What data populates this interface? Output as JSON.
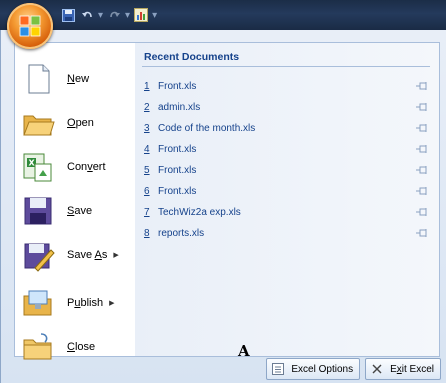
{
  "left_menu": [
    {
      "key": "new",
      "label": "New",
      "underline": "N",
      "has_arrow": false,
      "icon": "new-document-icon"
    },
    {
      "key": "open",
      "label": "Open",
      "underline": "O",
      "has_arrow": false,
      "icon": "open-folder-icon"
    },
    {
      "key": "convert",
      "label": "Convert",
      "underline": "v",
      "has_arrow": false,
      "icon": "convert-icon"
    },
    {
      "key": "save",
      "label": "Save",
      "underline": "S",
      "has_arrow": false,
      "icon": "save-icon"
    },
    {
      "key": "save_as",
      "label": "Save As",
      "underline": "A",
      "has_arrow": true,
      "icon": "save-as-icon"
    },
    {
      "key": "publish",
      "label": "Publish",
      "underline": "u",
      "has_arrow": true,
      "icon": "publish-icon"
    },
    {
      "key": "close",
      "label": "Close",
      "underline": "C",
      "has_arrow": false,
      "icon": "close-folder-icon"
    }
  ],
  "recent": {
    "title": "Recent Documents",
    "documents": [
      {
        "num": "1",
        "name": "Front.xls"
      },
      {
        "num": "2",
        "name": "admin.xls"
      },
      {
        "num": "3",
        "name": "Code of the month.xls"
      },
      {
        "num": "4",
        "name": "Front.xls"
      },
      {
        "num": "5",
        "name": "Front.xls"
      },
      {
        "num": "6",
        "name": "Front.xls"
      },
      {
        "num": "7",
        "name": "TechWiz2a exp.xls"
      },
      {
        "num": "8",
        "name": "reports.xls"
      }
    ]
  },
  "buttons": {
    "options": "Excel Options",
    "exit": "Exit Excel",
    "exit_underline": "x"
  },
  "annotation": "A",
  "colors": {
    "title_bar": "#1b2d47",
    "link_blue": "#15428b",
    "menu_bg": "#dde8f5"
  }
}
